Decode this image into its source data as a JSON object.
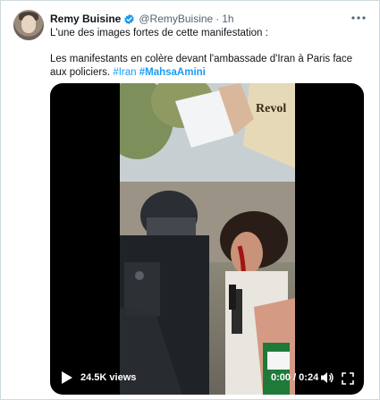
{
  "tweet": {
    "author_name": "Remy Buisine",
    "handle": "@RemyBuisine",
    "separator": "·",
    "time": "1h",
    "line1": "L'une des images fortes de cette manifestation :",
    "line2": "Les manifestants en colère devant l'ambassade d'Iran à Paris face aux policiers.",
    "hashtags": [
      "#Iran",
      "#MahsaAmini"
    ]
  },
  "video": {
    "views": "24.5K views",
    "duration": "0:00 / 0:24"
  },
  "icons": {
    "verified": "verified-badge-icon",
    "more": "more-options-icon",
    "play": "play-icon",
    "volume": "volume-icon",
    "fullscreen": "fullscreen-icon"
  },
  "colors": {
    "accent": "#1d9bf0",
    "text": "#0f1419",
    "secondary": "#536471"
  }
}
